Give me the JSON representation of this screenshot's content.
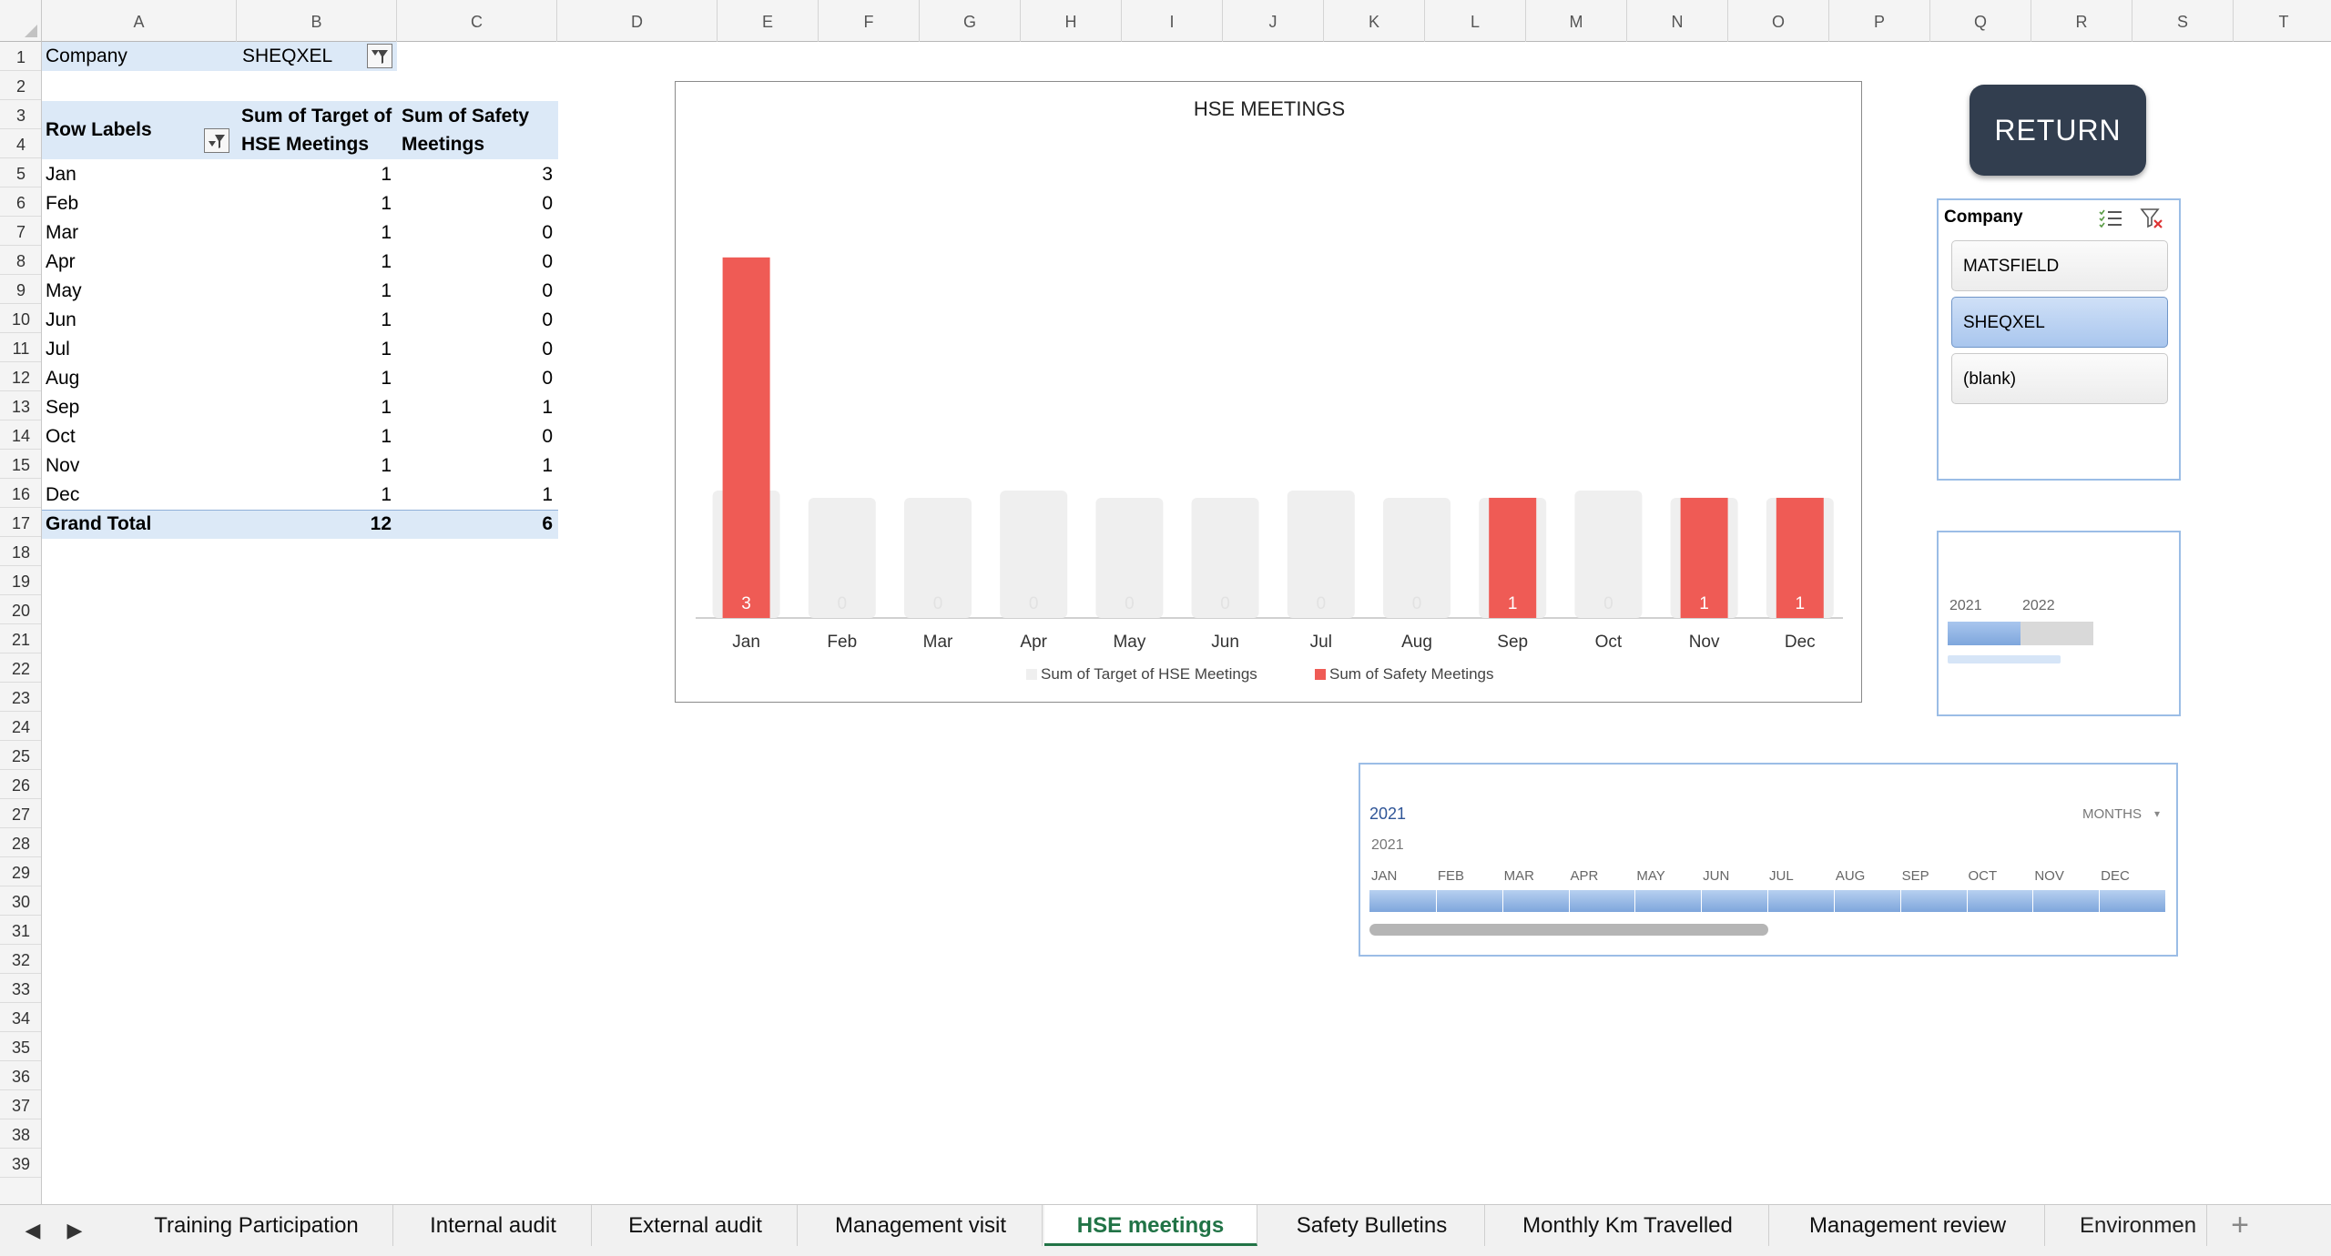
{
  "columns": [
    "A",
    "B",
    "C",
    "D",
    "E",
    "F",
    "G",
    "H",
    "I",
    "J",
    "K",
    "L",
    "M",
    "N",
    "O",
    "P",
    "Q",
    "R",
    "S",
    "T"
  ],
  "rows": [
    "1",
    "2",
    "3",
    "4",
    "5",
    "6",
    "7",
    "8",
    "9",
    "10",
    "11",
    "12",
    "13",
    "14",
    "15",
    "16",
    "17",
    "18",
    "19",
    "20",
    "21",
    "22",
    "23",
    "24",
    "25",
    "26",
    "27",
    "28",
    "29",
    "30",
    "31",
    "32",
    "33",
    "34",
    "35",
    "36",
    "37",
    "38",
    "39"
  ],
  "pivot": {
    "filter_label": "Company",
    "filter_value": "SHEQXEL",
    "row_labels_header": "Row Labels",
    "col_b_header_line1": "Sum of Target of",
    "col_b_header_line2": "HSE Meetings",
    "col_c_header_line1": "Sum of Safety",
    "col_c_header_line2": "Meetings",
    "rows": [
      {
        "label": "Jan",
        "target": "1",
        "safety": "3"
      },
      {
        "label": "Feb",
        "target": "1",
        "safety": "0"
      },
      {
        "label": "Mar",
        "target": "1",
        "safety": "0"
      },
      {
        "label": "Apr",
        "target": "1",
        "safety": "0"
      },
      {
        "label": "May",
        "target": "1",
        "safety": "0"
      },
      {
        "label": "Jun",
        "target": "1",
        "safety": "0"
      },
      {
        "label": "Jul",
        "target": "1",
        "safety": "0"
      },
      {
        "label": "Aug",
        "target": "1",
        "safety": "0"
      },
      {
        "label": "Sep",
        "target": "1",
        "safety": "1"
      },
      {
        "label": "Oct",
        "target": "1",
        "safety": "0"
      },
      {
        "label": "Nov",
        "target": "1",
        "safety": "1"
      },
      {
        "label": "Dec",
        "target": "1",
        "safety": "1"
      }
    ],
    "grand_total_label": "Grand Total",
    "grand_total_target": "12",
    "grand_total_safety": "6"
  },
  "chart_data": {
    "type": "bar",
    "title": "HSE MEETINGS",
    "categories": [
      "Jan",
      "Feb",
      "Mar",
      "Apr",
      "May",
      "Jun",
      "Jul",
      "Aug",
      "Sep",
      "Oct",
      "Nov",
      "Dec"
    ],
    "series": [
      {
        "name": "Sum of Target of HSE Meetings",
        "values": [
          1,
          1,
          1,
          1,
          1,
          1,
          1,
          1,
          1,
          1,
          1,
          1
        ],
        "color": "#efefef"
      },
      {
        "name": "Sum of Safety Meetings",
        "values": [
          3,
          0,
          0,
          0,
          0,
          0,
          0,
          0,
          1,
          0,
          1,
          1
        ],
        "color": "#ef5b55"
      }
    ],
    "data_labels": [
      "3",
      "0",
      "0",
      "0",
      "0",
      "0",
      "0",
      "0",
      "1",
      "0",
      "1",
      "1"
    ],
    "ylim": [
      0,
      3.4
    ],
    "grid": false,
    "legend": "bottom"
  },
  "return_button": "RETURN",
  "slicer": {
    "title": "Company",
    "items": [
      {
        "label": "MATSFIELD",
        "selected": false
      },
      {
        "label": "SHEQXEL",
        "selected": true
      },
      {
        "label": "(blank)",
        "selected": false
      }
    ]
  },
  "year_timeline": {
    "years": [
      "2021",
      "2022"
    ],
    "selected": "2021"
  },
  "month_timeline": {
    "caption": "2021",
    "level": "MONTHS",
    "year_label": "2021",
    "months": [
      "JAN",
      "FEB",
      "MAR",
      "APR",
      "MAY",
      "JUN",
      "JUL",
      "AUG",
      "SEP",
      "OCT",
      "NOV",
      "DEC"
    ]
  },
  "tabs": [
    {
      "label": "Training Participation",
      "active": false
    },
    {
      "label": "Internal audit",
      "active": false
    },
    {
      "label": "External audit",
      "active": false
    },
    {
      "label": "Management visit",
      "active": false
    },
    {
      "label": "HSE meetings",
      "active": true
    },
    {
      "label": "Safety Bulletins",
      "active": false
    },
    {
      "label": "Monthly Km Travelled",
      "active": false
    },
    {
      "label": "Management review",
      "active": false
    },
    {
      "label": "Environmen",
      "active": false
    }
  ],
  "add_sheet_symbol": "+",
  "colors": {
    "accent": "#217346",
    "bar_red": "#ef5b55",
    "bar_grey": "#efefef",
    "pivot_band": "#dce9f7",
    "return_bg": "#323e4f"
  }
}
